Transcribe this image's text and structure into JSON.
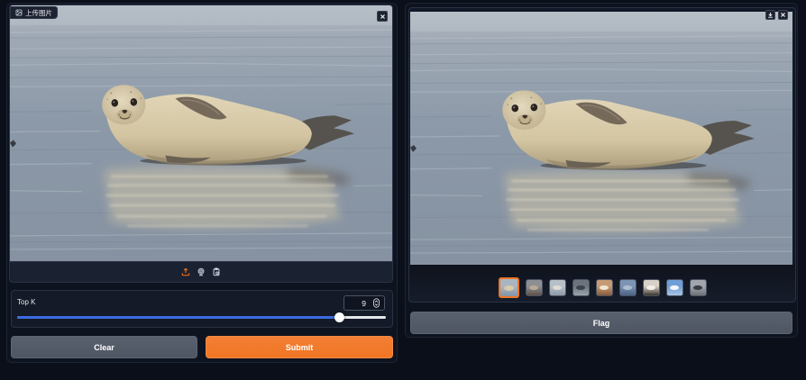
{
  "upload": {
    "label": "上传图片",
    "label_icon": "image-icon",
    "close_icon": "close-icon",
    "source_icons": [
      "upload-icon",
      "webcam-icon",
      "clipboard-icon"
    ]
  },
  "top_k": {
    "label": "Top K",
    "value": "9",
    "slider_level": 0.875
  },
  "actions": {
    "clear_label": "Clear",
    "submit_label": "Submit"
  },
  "gallery": {
    "toolbar_icons": [
      "download-icon",
      "close-icon"
    ],
    "selected_index": 0,
    "thumbnails": [
      {
        "colors": [
          "#aab5c2",
          "#8493a6",
          "#d8cba8"
        ]
      },
      {
        "colors": [
          "#8d8f93",
          "#5f5246",
          "#b6aa98"
        ]
      },
      {
        "colors": [
          "#b7c0c9",
          "#8e99a5",
          "#e0dcd3"
        ]
      },
      {
        "colors": [
          "#6c737c",
          "#9aa3ac",
          "#3d434b"
        ]
      },
      {
        "colors": [
          "#c59a74",
          "#8a5a3c",
          "#efe4d2"
        ]
      },
      {
        "colors": [
          "#7d94b5",
          "#4c6386",
          "#aebcd0"
        ]
      },
      {
        "colors": [
          "#d7d1c7",
          "#39342f",
          "#f2efe9"
        ]
      },
      {
        "colors": [
          "#6f9fd8",
          "#a9c3e3",
          "#f4f6f9"
        ]
      },
      {
        "colors": [
          "#a1a6ac",
          "#6d7279",
          "#3a3e44"
        ]
      }
    ]
  },
  "flag": {
    "label": "Flag"
  },
  "colors": {
    "accent": "#f07524",
    "slider_fill": "#3b6ce0",
    "secondary_button": "#4f5663",
    "background": "#0b0f19"
  }
}
